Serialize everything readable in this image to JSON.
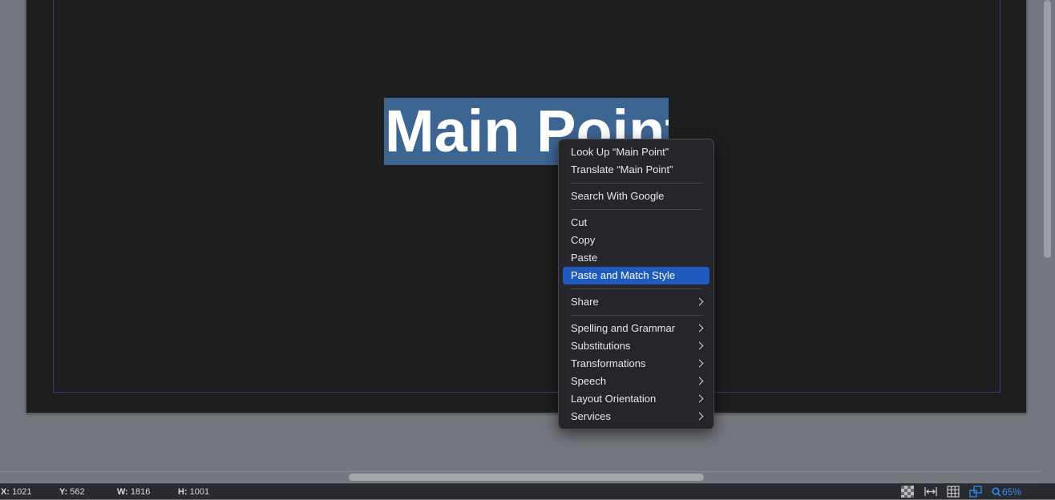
{
  "canvas": {
    "title_text": "Main Point"
  },
  "context_menu": {
    "items": [
      {
        "label": "Look Up “Main Point”",
        "submenu": false
      },
      {
        "label": "Translate “Main Point”",
        "submenu": false
      },
      {
        "separator": true
      },
      {
        "label": "Search With Google",
        "submenu": false
      },
      {
        "separator": true
      },
      {
        "label": "Cut",
        "submenu": false
      },
      {
        "label": "Copy",
        "submenu": false
      },
      {
        "label": "Paste",
        "submenu": false
      },
      {
        "label": "Paste and Match Style",
        "submenu": false,
        "highlighted": true
      },
      {
        "separator": true
      },
      {
        "label": "Share",
        "submenu": true
      },
      {
        "separator": true
      },
      {
        "label": "Spelling and Grammar",
        "submenu": true
      },
      {
        "label": "Substitutions",
        "submenu": true
      },
      {
        "label": "Transformations",
        "submenu": true
      },
      {
        "label": "Speech",
        "submenu": true
      },
      {
        "label": "Layout Orientation",
        "submenu": true
      },
      {
        "label": "Services",
        "submenu": true
      }
    ]
  },
  "status_bar": {
    "x_label": "X:",
    "x_value": "1021",
    "y_label": "Y:",
    "y_value": "562",
    "w_label": "W:",
    "w_value": "1816",
    "h_label": "H:",
    "h_value": "1001",
    "zoom": "65%",
    "icons": [
      "transparency-checker-icon",
      "fit-width-icon",
      "grid-icon",
      "snap-icon",
      "zoom-icon"
    ]
  },
  "colors": {
    "selection": "#3d6592",
    "menu_highlight": "#1f5bbf",
    "accent": "#2f8cff"
  }
}
